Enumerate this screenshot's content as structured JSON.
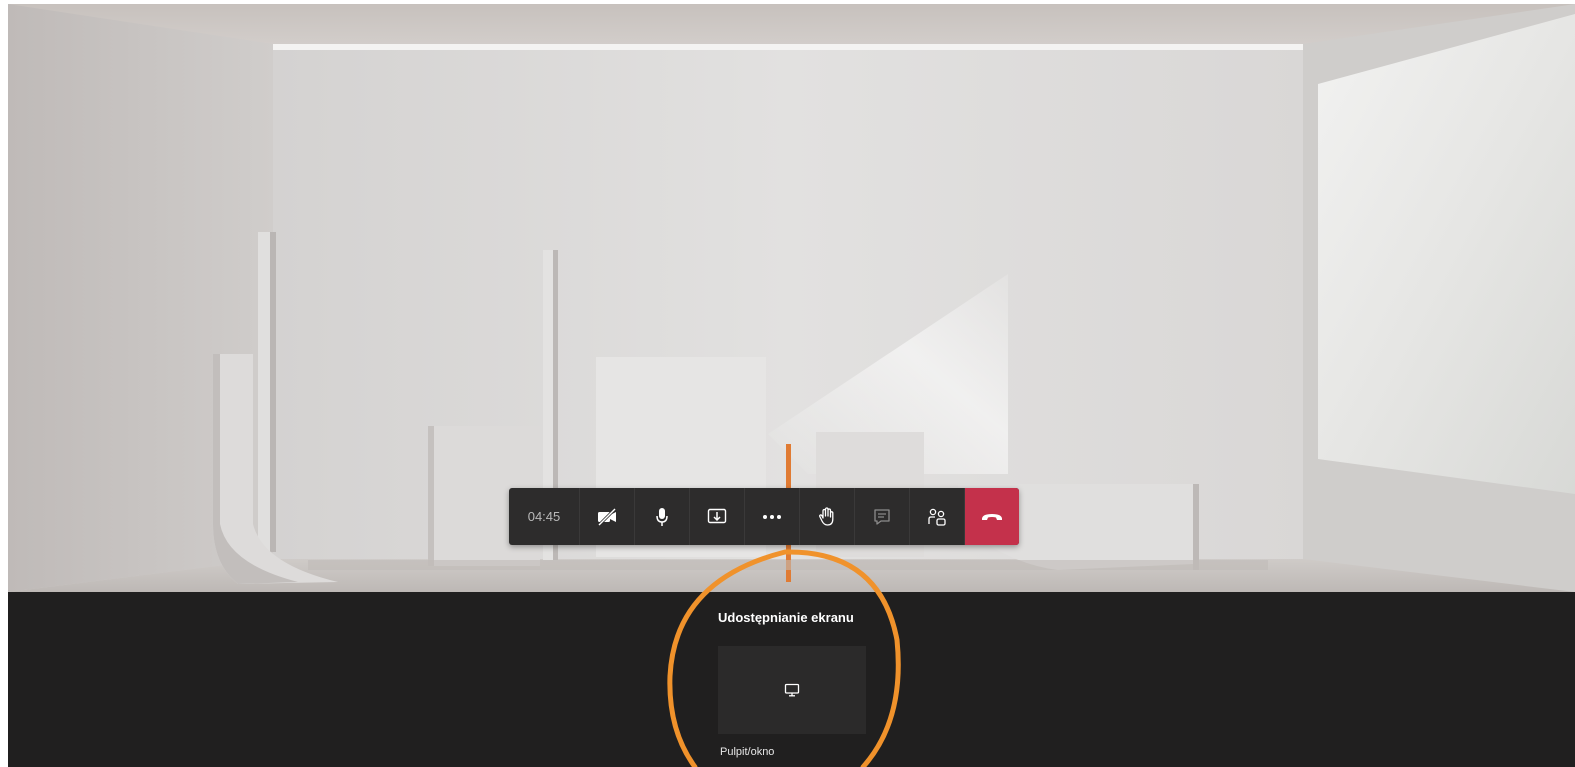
{
  "call": {
    "timer": "04:45"
  },
  "toolbar": {
    "buttons": [
      {
        "name": "camera-off-icon",
        "tooltip": ""
      },
      {
        "name": "microphone-icon"
      },
      {
        "name": "share-tray-icon"
      },
      {
        "name": "more-actions-icon"
      },
      {
        "name": "raise-hand-icon"
      },
      {
        "name": "chat-icon"
      },
      {
        "name": "participants-icon"
      },
      {
        "name": "hang-up-icon"
      }
    ]
  },
  "share": {
    "title": "Udostępnianie ekranu",
    "tile_icon": "monitor-icon",
    "option_label": "Pulpit/okno"
  },
  "colors": {
    "toolbar_bg": "#2d2c2c",
    "hangup": "#c4314b",
    "panel_bg": "#201f1f",
    "annotation": "#f0922b"
  }
}
